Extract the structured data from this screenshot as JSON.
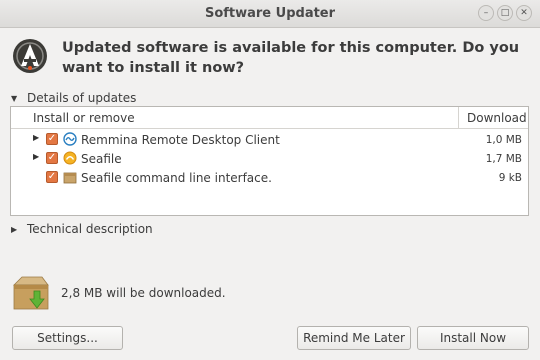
{
  "window": {
    "title": "Software Updater",
    "controls": [
      "–",
      "□",
      "✕"
    ]
  },
  "header": {
    "icon": "software-updater-icon",
    "message": "Updated software is available for this computer. Do you want to install it now?"
  },
  "details": {
    "label": "Details of updates",
    "expanded": true,
    "columns": {
      "install": "Install or remove",
      "download": "Download"
    },
    "rows": [
      {
        "name": "Remmina Remote Desktop Client",
        "size": "1,0 MB",
        "checked": true,
        "expandable": true,
        "icon": "remmina-icon"
      },
      {
        "name": "Seafile",
        "size": "1,7 MB",
        "checked": true,
        "expandable": true,
        "icon": "seafile-icon"
      },
      {
        "name": "Seafile command line interface.",
        "size": "9 kB",
        "checked": true,
        "expandable": false,
        "icon": "package-icon"
      }
    ]
  },
  "technical": {
    "label": "Technical description",
    "expanded": false
  },
  "download": {
    "text": "2,8 MB will be downloaded."
  },
  "buttons": {
    "settings": "Settings...",
    "remind": "Remind Me Later",
    "install": "Install Now"
  },
  "colors": {
    "checkbox": "#e37743",
    "accent": "#e95420"
  }
}
